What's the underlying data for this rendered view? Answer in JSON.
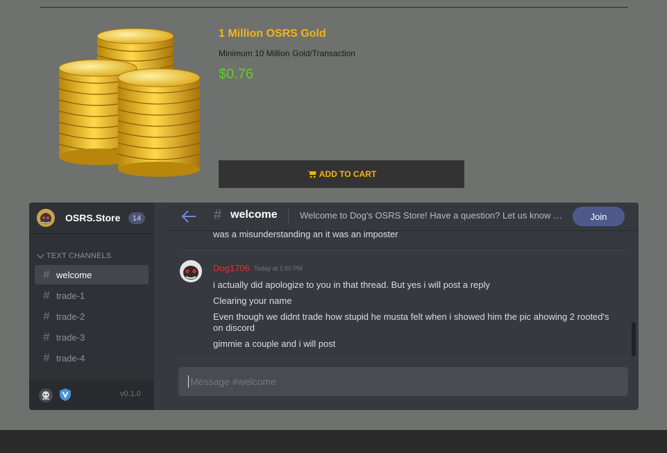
{
  "product": {
    "title": "1 Million OSRS Gold",
    "subtitle": "Minimum 10 Million Gold/Transaction",
    "price": "$0.76",
    "add_to_cart": "ADD TO CART",
    "image_icon": "gold-coins-stack",
    "colors": {
      "title": "#f5b511",
      "price": "#5fd11f"
    }
  },
  "widget": {
    "server_name": "OSRS.Store",
    "online_count": "14",
    "category": "TEXT CHANNELS",
    "channels": [
      {
        "name": "welcome",
        "active": true
      },
      {
        "name": "trade-1",
        "active": false
      },
      {
        "name": "trade-2",
        "active": false
      },
      {
        "name": "trade-3",
        "active": false
      },
      {
        "name": "trade-4",
        "active": false
      }
    ],
    "version": "v0.1.0",
    "header": {
      "channel": "welcome",
      "topic": "Welcome to Dog's OSRS Store! Have a question? Let us know and we will help you!",
      "join": "Join"
    },
    "messages": {
      "previous_line": "was a misunderstanding an it was an imposter",
      "author": "Dog1706",
      "timestamp": "Today at 1:50 PM",
      "author_color": "#e03131",
      "lines": [
        "i actually did apologize to you in that thread. But yes i will post a reply",
        "Clearing your name",
        "Even though we didnt trade how stupid he musta felt when i showed him the pic ahowing 2 rooted's on discord",
        "gimmie a couple and i will post"
      ]
    },
    "composer_placeholder": "Message #welcome"
  }
}
